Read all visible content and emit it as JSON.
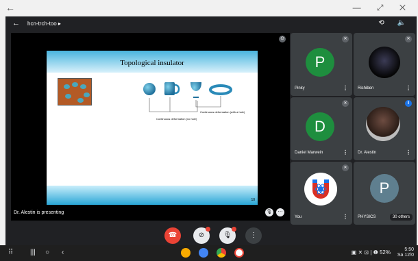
{
  "window": {
    "back_icon": "←",
    "controls": "— ⤢ ✕"
  },
  "meet": {
    "code": "hcn-trch-too ▸",
    "header_icons": "⟲ 🔈",
    "presentation": {
      "slide_title": "Topological insulator",
      "caption_left": "Continuous deformation (no hole)",
      "caption_right": "Continuous deformation (with a hole)",
      "page_number": "10",
      "presenting_text": "Dr. Alestin  is presenting"
    },
    "participants": [
      {
        "name": "Pinky",
        "initial": "P",
        "color": "#1e8e3e"
      },
      {
        "name": "Rishiben",
        "initial": "",
        "color": "#000000"
      },
      {
        "name": "Daniel Marwein",
        "initial": "D",
        "color": "#1e8e3e"
      },
      {
        "name": "Dr. Alestin",
        "initial": "",
        "color": "#ffffff"
      },
      {
        "name": "You",
        "initial": "",
        "color": "#ffffff"
      },
      {
        "name": "PHYSICS",
        "initial": "P",
        "color": "#5f7f8f"
      }
    ],
    "others_label": "30 others",
    "controls": {
      "end_call_icon": "end-call-icon",
      "camera_icon": "camera-off-icon",
      "mic_icon": "mic-off-icon",
      "more_icon": "more-vert-icon"
    }
  },
  "navbar": {
    "status": "▣ ✕ ⊡ | ❶ 52%",
    "time": "5:50",
    "date": "Sa 12/0"
  }
}
